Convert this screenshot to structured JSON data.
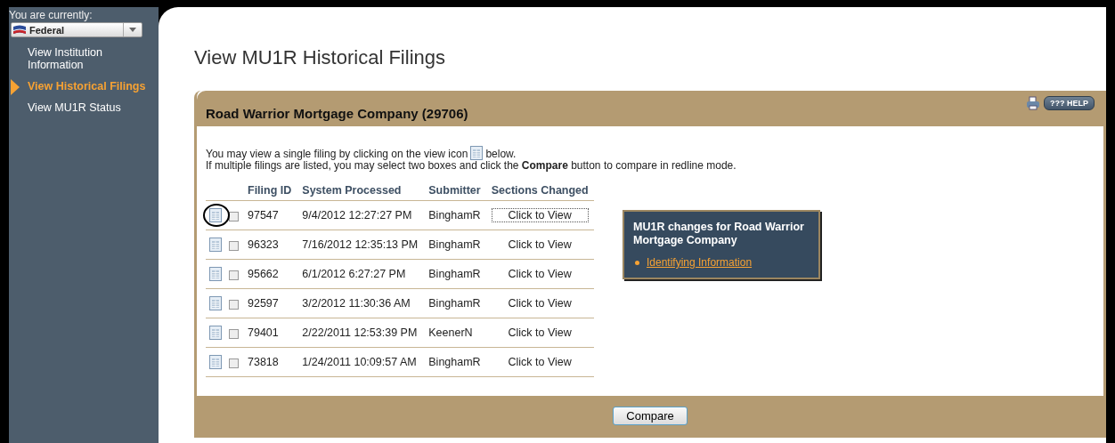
{
  "sidebar": {
    "context_label": "You are currently:",
    "context_select": {
      "value": "Federal"
    },
    "items": [
      {
        "label": "View Institution Information",
        "selected": false
      },
      {
        "label": "View Historical Filings",
        "selected": true
      },
      {
        "label": "View MU1R Status",
        "selected": false
      }
    ]
  },
  "page_title": "View MU1R Historical Filings",
  "panel": {
    "title": "Road Warrior Mortgage Company (29706)",
    "help_label": "??? HELP",
    "intro_before_icon": "You may view a single filing by clicking on the view icon",
    "intro_after_icon": "below.",
    "intro_line_2": "If multiple filings are listed, you may select two boxes and click the **Compare** button to compare in redline mode.",
    "table": {
      "columns": [
        "Filing ID",
        "System Processed",
        "Submitter",
        "Sections Changed"
      ],
      "rows": [
        {
          "filing_id": "97547",
          "processed": "9/4/2012 12:27:27 PM",
          "submitter": "BinghamR",
          "sections": "Click to View",
          "checked": false,
          "focused": true,
          "circled": true
        },
        {
          "filing_id": "96323",
          "processed": "7/16/2012 12:35:13 PM",
          "submitter": "BinghamR",
          "sections": "Click to View",
          "checked": false,
          "focused": false,
          "circled": false
        },
        {
          "filing_id": "95662",
          "processed": "6/1/2012 6:27:27 PM",
          "submitter": "BinghamR",
          "sections": "Click to View",
          "checked": false,
          "focused": false,
          "circled": false
        },
        {
          "filing_id": "92597",
          "processed": "3/2/2012 11:30:36 AM",
          "submitter": "BinghamR",
          "sections": "Click to View",
          "checked": false,
          "focused": false,
          "circled": false
        },
        {
          "filing_id": "79401",
          "processed": "2/22/2011 12:53:39 PM",
          "submitter": "KeenerN",
          "sections": "Click to View",
          "checked": false,
          "focused": false,
          "circled": false
        },
        {
          "filing_id": "73818",
          "processed": "1/24/2011 10:09:57 AM",
          "submitter": "BinghamR",
          "sections": "Click to View",
          "checked": false,
          "focused": false,
          "circled": false
        }
      ]
    },
    "changes_popup": {
      "title": "MU1R changes for Road Warrior Mortgage Company",
      "items": [
        "Identifying Information"
      ]
    },
    "compare_button": "Compare"
  }
}
